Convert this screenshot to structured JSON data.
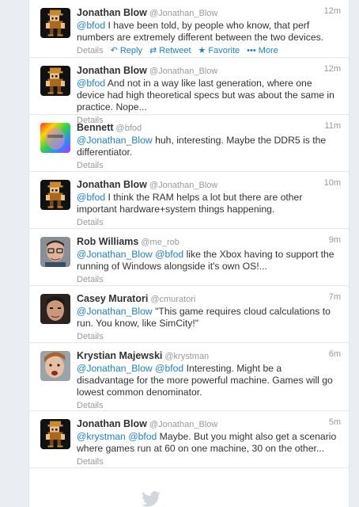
{
  "tweets": [
    {
      "name": "Jonathan Blow",
      "handle": "@Jonathan_Blow",
      "time": "12m",
      "avatar": "pixel-character",
      "text": [
        {
          "t": "@bfod",
          "mention": true
        },
        {
          "t": " I have been told, by people who know, that perf numbers are extremely different between the two devices.",
          "mention": false
        }
      ],
      "details": "Details",
      "reply": "Reply",
      "retweet": "Retweet",
      "favorite": "Favorite",
      "more": "More"
    },
    {
      "name": "Jonathan Blow",
      "handle": "@Jonathan_Blow",
      "time": "12m",
      "avatar": "pixel-character",
      "text": [
        {
          "t": "@bfod",
          "mention": true
        },
        {
          "t": " And not in a way like last generation, where one device had high theoretical specs but was about the same in practice. Nope...",
          "mention": false
        }
      ],
      "details": "Details"
    },
    {
      "name": "Bennett",
      "handle": "@bfod",
      "time": "11m",
      "avatar": "rainbow-face",
      "text": [
        {
          "t": "@Jonathan_Blow",
          "mention": true
        },
        {
          "t": " huh, interesting. Maybe the DDR5 is the differentiator.",
          "mention": false
        }
      ],
      "details": "Details"
    },
    {
      "name": "Jonathan Blow",
      "handle": "@Jonathan_Blow",
      "time": "10m",
      "avatar": "pixel-character",
      "text": [
        {
          "t": "@bfod",
          "mention": true
        },
        {
          "t": " I think the RAM helps a lot but there are other important hardware+system things happening.",
          "mention": false
        }
      ],
      "details": "Details"
    },
    {
      "name": "Rob Williams",
      "handle": "@me_rob",
      "time": "9m",
      "avatar": "photo-glasses",
      "text": [
        {
          "t": "@Jonathan_Blow",
          "mention": true
        },
        {
          "t": " ",
          "mention": false
        },
        {
          "t": "@bfod",
          "mention": true
        },
        {
          "t": " like the Xbox having to support the running of Windows alongside it's own OS!...",
          "mention": false
        }
      ],
      "details": "Details"
    },
    {
      "name": "Casey Muratori",
      "handle": "@cmuratori",
      "time": "7m",
      "avatar": "photo-man",
      "text": [
        {
          "t": "@Jonathan_Blow",
          "mention": true
        },
        {
          "t": " \"This game requires cloud calculations to run. You know, like SimCity!\"",
          "mention": false
        }
      ],
      "details": "Details"
    },
    {
      "name": "Krystian Majewski",
      "handle": "@krystman",
      "time": "6m",
      "avatar": "photo-young",
      "text": [
        {
          "t": "@Jonathan_Blow",
          "mention": true
        },
        {
          "t": " ",
          "mention": false
        },
        {
          "t": "@bfod",
          "mention": true
        },
        {
          "t": " Interesting. Might be a disadvantage for the more powerful machine. Games will go lowest common denominator.",
          "mention": false
        }
      ],
      "details": "Details"
    },
    {
      "name": "Jonathan Blow",
      "handle": "@Jonathan_Blow",
      "time": "5m",
      "avatar": "pixel-character",
      "text": [
        {
          "t": "@krystman",
          "mention": true
        },
        {
          "t": " ",
          "mention": false
        },
        {
          "t": "@bfod",
          "mention": true
        },
        {
          "t": " Maybe. But you might also get a scenario where games run at 60 on one machine, 30 on the other...",
          "mention": false
        }
      ],
      "details": "Details"
    }
  ],
  "colors": {
    "mention": "#1f82c0",
    "muted": "#999999",
    "background": "#e8eef2"
  },
  "footer_icon": "twitter-bird-icon"
}
